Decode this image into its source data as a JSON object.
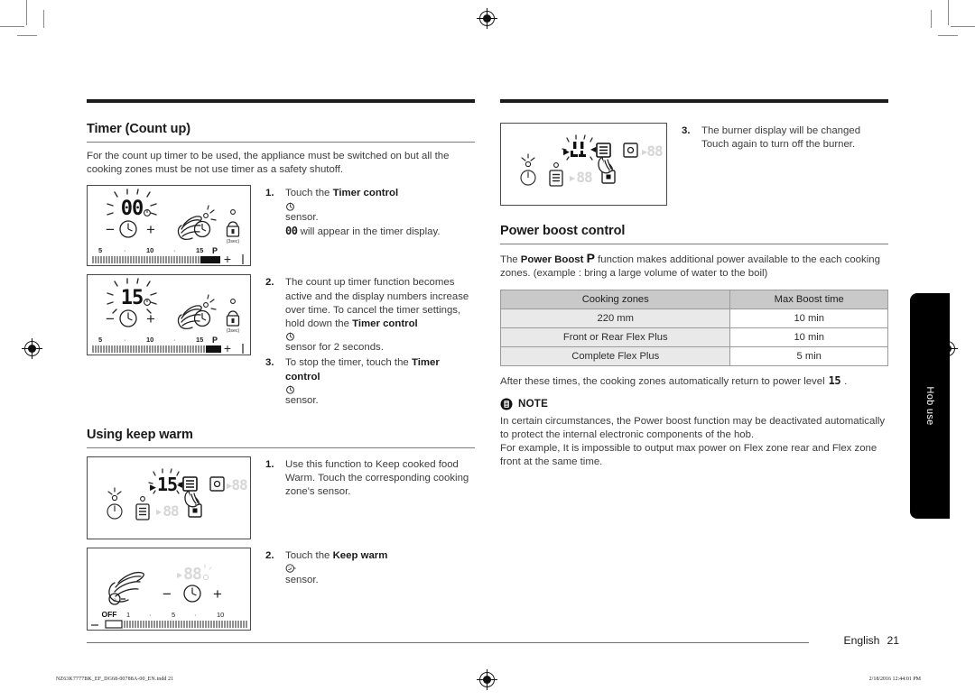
{
  "document": {
    "language_label": "English",
    "page_number": "21",
    "side_tab": "Hob use",
    "imprint_left": "NZ63K7777BK_EF_DG68-00788A-00_EN.indd   21",
    "imprint_right": "2/18/2016   12:44:01 PM"
  },
  "left_column": {
    "section1": {
      "heading": "Timer (Count up)",
      "intro": "For the count up timer to be used, the appliance must be switched on but all the cooking zones must be not use timer as a safety shutoff.",
      "steps": [
        {
          "num": "1.",
          "parts": [
            {
              "t": "Touch the ",
              "b": false
            },
            {
              "t": "Timer control",
              "b": true
            },
            {
              "t": " ⏱ sensor.",
              "b": false
            }
          ],
          "text": "Touch the Timer control ⏱ sensor. 00 will appear in the timer display.",
          "line1_pre": "Touch the ",
          "line1_bold": "Timer control",
          "line1_post": " sensor.",
          "line2_pre": "",
          "line2_display": "00",
          "line2_post": " will appear in the timer display."
        },
        {
          "num": "2.",
          "pre": "The count up timer function becomes active and the display numbers increase over time. To cancel the timer settings, hold down the ",
          "bold": "Timer control",
          "post": " sensor for 2 seconds."
        },
        {
          "num": "3.",
          "pre": "To stop the timer, touch the ",
          "bold": "Timer control",
          "post": " sensor."
        }
      ]
    },
    "section2": {
      "heading": "Using keep warm",
      "steps": [
        {
          "num": "1.",
          "text": "Use this function to Keep cooked food Warm. Touch the corresponding cooking zone's sensor."
        },
        {
          "num": "2.",
          "pre": "Touch the ",
          "bold": "Keep warm",
          "post": " sensor."
        }
      ]
    },
    "figures": {
      "timer_00": {
        "display": "00",
        "minus": "−",
        "plus": "+",
        "scale_labels": [
          "5",
          "·",
          "10",
          "·",
          "15",
          "P"
        ],
        "lock_caption": "(3sec)"
      },
      "timer_15": {
        "display": "15",
        "minus": "−",
        "plus": "+",
        "scale_labels": [
          "5",
          "·",
          "10",
          "·",
          "15",
          "P"
        ],
        "lock_caption": "(3sec)"
      },
      "keepwarm_zone": {
        "display": "15",
        "ghost_display": "88"
      },
      "keepwarm_slider": {
        "ghost_display": "88",
        "minus": "−",
        "plus": "+",
        "scale_labels": [
          "OFF",
          "1",
          "·",
          "5",
          "·",
          "10"
        ]
      }
    }
  },
  "right_column": {
    "top_step": {
      "num": "3.",
      "line1": "The burner display will be changed",
      "line2": "Touch again to turn off the burner."
    },
    "figure_burner": {
      "display": "II",
      "ghost_display": "88"
    },
    "section": {
      "heading": "Power boost control",
      "intro_pre": "The ",
      "intro_bold": "Power Boost",
      "intro_glyph": "P",
      "intro_post": " function makes additional power available to the each cooking zones. (example : bring a large volume of water to the boil)"
    },
    "table": {
      "headers": [
        "Cooking zones",
        "Max Boost time"
      ],
      "rows": [
        {
          "zone": "220 mm",
          "time": "10 min"
        },
        {
          "zone": "Front or Rear Flex Plus",
          "time": "10 min"
        },
        {
          "zone": "Complete Flex Plus",
          "time": "5 min"
        }
      ]
    },
    "after_table": {
      "text": "After these times, the cooking zones automatically return to power level",
      "level": "15",
      "period": "."
    },
    "note": {
      "label": "NOTE",
      "body": "In certain circumstances, the Power boost function may be deactivated automatically to protect the internal electronic components of the hob.\nFor example, It is impossible to output max power on Flex zone rear and Flex zone front at the same time."
    }
  },
  "colors": {
    "rule": "#1c1c1c",
    "table_header_bg": "#c9c9c9",
    "table_zone_bg": "#e9e9e9",
    "side_tab_bg": "#000000",
    "text": "#3c3c3c"
  }
}
